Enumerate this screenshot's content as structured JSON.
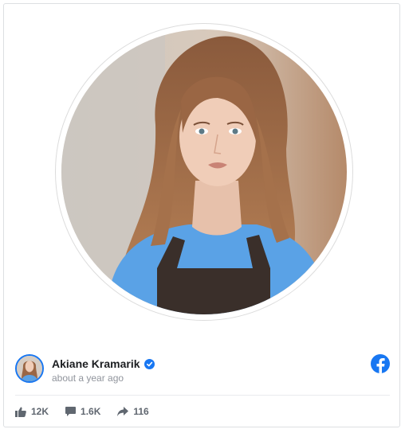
{
  "post": {
    "author_name": "Akiane Kramarik",
    "timestamp": "about a year ago",
    "verified": true
  },
  "stats": {
    "likes": "12K",
    "comments": "1.6K",
    "shares": "116"
  },
  "colors": {
    "accent": "#1877f2",
    "muted_text": "#90949c",
    "stat_text": "#606770"
  },
  "icons": {
    "verified": "verified-badge-icon",
    "brand": "facebook-logo-icon",
    "like": "thumbs-up-icon",
    "comment": "comment-bubble-icon",
    "share": "share-arrow-icon"
  }
}
